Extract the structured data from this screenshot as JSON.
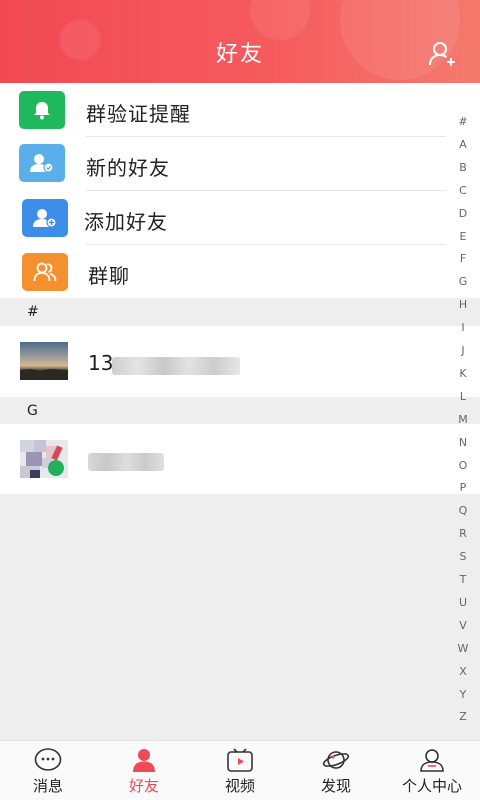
{
  "header": {
    "title": "好友",
    "add_friend_icon": "add-user-icon",
    "gradient": [
      "#f24a55",
      "#f57a6e"
    ]
  },
  "menu": [
    {
      "label": "群验证提醒",
      "icon": "bell-icon",
      "color": "#1fb85c"
    },
    {
      "label": "新的好友",
      "icon": "new-friend-icon",
      "color": "#5aaeea"
    },
    {
      "label": "添加好友",
      "icon": "add-friend-icon",
      "color": "#3d8ee8"
    },
    {
      "label": "群聊",
      "icon": "group-chat-icon",
      "color": "#f4902e"
    }
  ],
  "sections": [
    {
      "label": "#",
      "contacts": [
        {
          "name": "13",
          "avatar": "sunset-photo-avatar"
        }
      ]
    },
    {
      "label": "G",
      "contacts": [
        {
          "name": "",
          "avatar": "mosaic-avatar"
        }
      ]
    }
  ],
  "alpha_index": [
    "#",
    "A",
    "B",
    "C",
    "D",
    "E",
    "F",
    "G",
    "H",
    "I",
    "J",
    "K",
    "L",
    "M",
    "N",
    "O",
    "P",
    "Q",
    "R",
    "S",
    "T",
    "U",
    "V",
    "W",
    "X",
    "Y",
    "Z"
  ],
  "tabs": [
    {
      "label": "消息",
      "icon": "message-icon",
      "active": false
    },
    {
      "label": "好友",
      "icon": "friends-icon",
      "active": true
    },
    {
      "label": "视频",
      "icon": "video-icon",
      "active": false
    },
    {
      "label": "发现",
      "icon": "planet-icon",
      "active": false
    },
    {
      "label": "个人中心",
      "icon": "profile-icon",
      "active": false
    }
  ],
  "colors": {
    "accent": "#ef4a55",
    "background": "#efeeee"
  }
}
